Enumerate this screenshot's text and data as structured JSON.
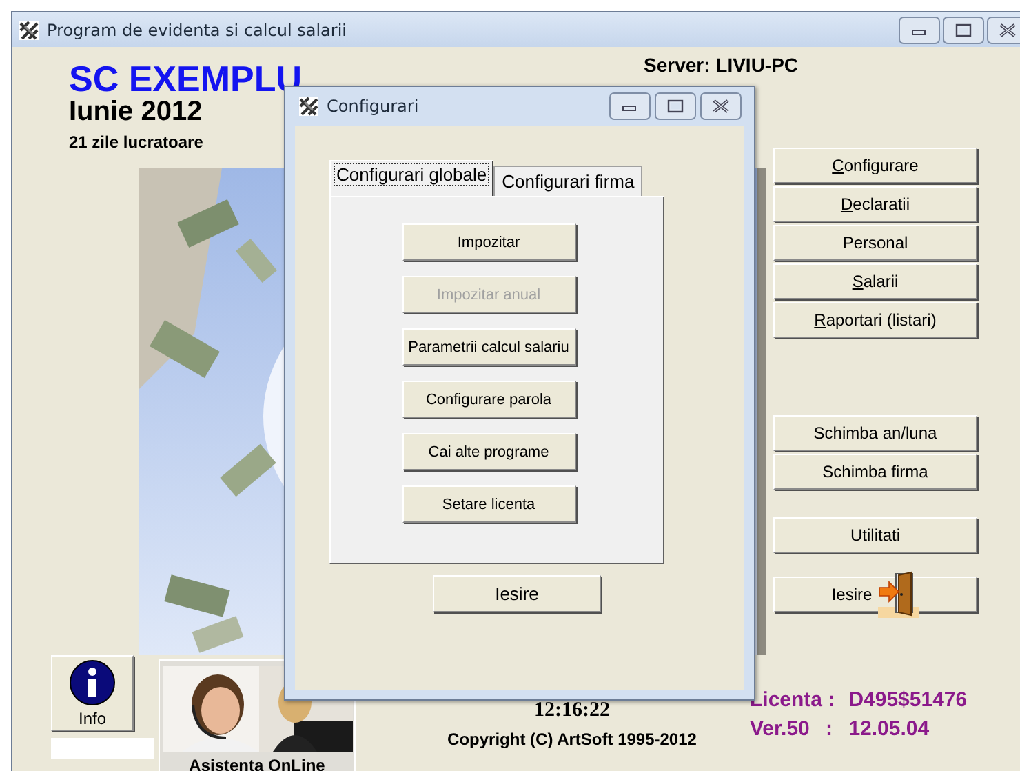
{
  "window": {
    "title": "Program de evidenta si calcul salarii"
  },
  "company": {
    "name": "SC EXEMPLU",
    "period": "Iunie 2012",
    "working_days": "21 zile lucratoare"
  },
  "server": "Server: LIVIU-PC",
  "menu_groups": [
    {
      "buttons": [
        {
          "label": "Configurare",
          "accelerator": true
        },
        {
          "label": "Declaratii",
          "accelerator": true
        },
        {
          "label": "Personal",
          "accelerator": false
        },
        {
          "label": "Salarii",
          "accelerator": true
        },
        {
          "label": "Raportari (listari)",
          "accelerator": true
        }
      ]
    },
    {
      "buttons": [
        {
          "label": "Schimba an/luna",
          "accelerator": false
        },
        {
          "label": "Schimba firma",
          "accelerator": false
        }
      ]
    },
    {
      "buttons": [
        {
          "label": "Utilitati",
          "accelerator": false
        }
      ]
    }
  ],
  "exit_button": {
    "label": "Iesire"
  },
  "info_button": {
    "label": "Info"
  },
  "support": {
    "label": "Asistenta OnLine"
  },
  "clock": "12:16:22",
  "copyright": "Copyright (C) ArtSoft 1995-2012",
  "license": {
    "label": "Licenta :",
    "value": "D495$51476"
  },
  "version": {
    "label": "Ver.50",
    "separator": ":",
    "value": "12.05.04"
  },
  "dialog": {
    "title": "Configurari",
    "tabs": [
      {
        "label": "Configurari globale",
        "selected": true
      },
      {
        "label": "Configurari firma",
        "selected": false
      }
    ],
    "buttons": [
      {
        "label": "Impozitar",
        "disabled": false
      },
      {
        "label": "Impozitar anual",
        "disabled": true
      },
      {
        "label": "Parametrii calcul salariu",
        "disabled": false
      },
      {
        "label": "Configurare parola",
        "disabled": false
      },
      {
        "label": "Cai alte programe",
        "disabled": false
      },
      {
        "label": "Setare licenta",
        "disabled": false
      }
    ],
    "exit_button": {
      "label": "Iesire"
    }
  }
}
